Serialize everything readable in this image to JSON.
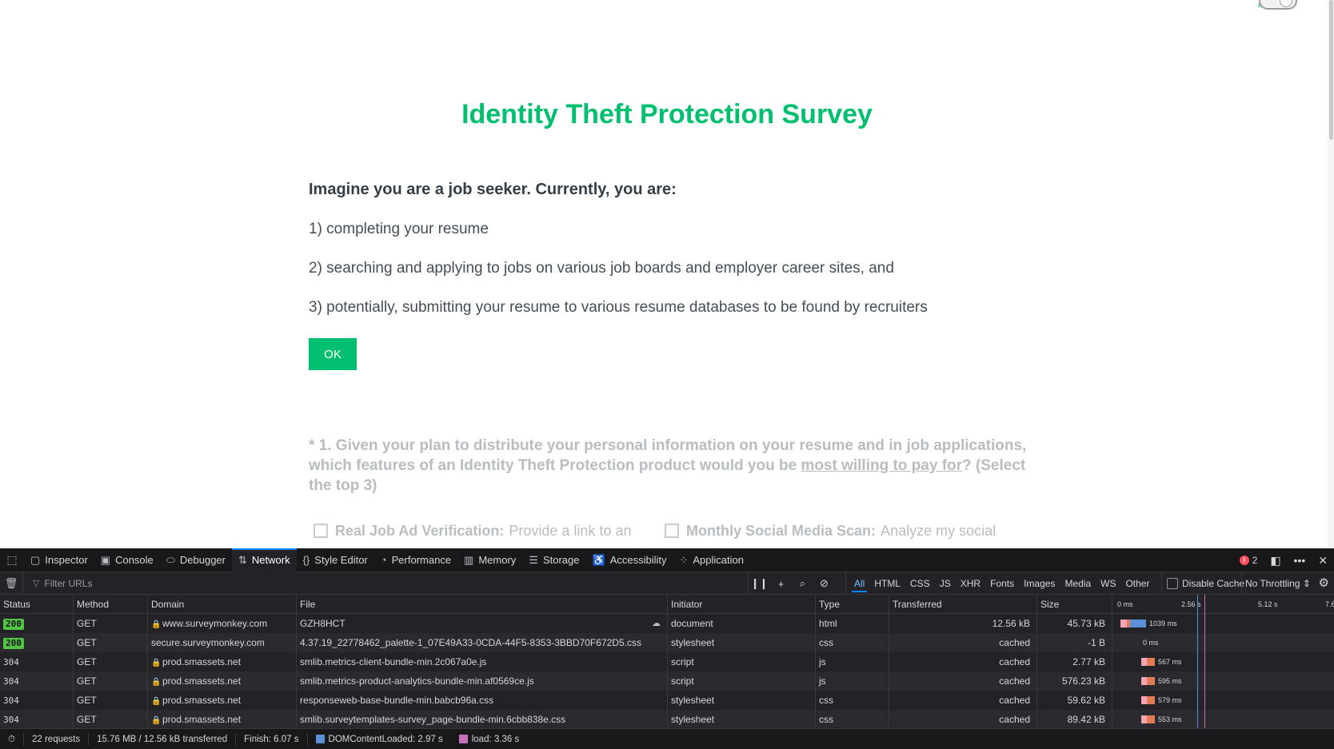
{
  "survey": {
    "title": "Identity Theft Protection Survey",
    "intro_heading": "Imagine you are a job seeker. Currently, you are:",
    "intro_lines": [
      "1) completing your resume",
      "2) searching and applying to jobs on various job boards and employer career sites, and",
      "3) potentially, submitting your resume to various resume databases to be found by recruiters"
    ],
    "ok_label": "OK",
    "question1": {
      "prefix": "* 1. Given your plan to distribute your personal information on your resume and in job applications, which features of an Identity Theft Protection product would you be ",
      "emphasis": "most willing to pay for",
      "suffix": "? (Select the top 3)"
    },
    "options": [
      {
        "title": "Real Job Ad Verification:",
        "desc": "Provide a link to an"
      },
      {
        "title": "Monthly Social Media Scan:",
        "desc": "Analyze my social"
      }
    ],
    "brand_color": "#00bf6f"
  },
  "devtools": {
    "tabs": [
      {
        "label": "Inspector",
        "icon": "inspector-icon"
      },
      {
        "label": "Console",
        "icon": "console-icon"
      },
      {
        "label": "Debugger",
        "icon": "debugger-icon"
      },
      {
        "label": "Network",
        "icon": "network-icon",
        "active": true
      },
      {
        "label": "Style Editor",
        "icon": "style-editor-icon"
      },
      {
        "label": "Performance",
        "icon": "performance-icon"
      },
      {
        "label": "Memory",
        "icon": "memory-icon"
      },
      {
        "label": "Storage",
        "icon": "storage-icon"
      },
      {
        "label": "Accessibility",
        "icon": "accessibility-icon"
      },
      {
        "label": "Application",
        "icon": "application-icon"
      }
    ],
    "error_count": "2",
    "filter_placeholder": "Filter URLs",
    "type_filters": [
      "All",
      "HTML",
      "CSS",
      "JS",
      "XHR",
      "Fonts",
      "Images",
      "Media",
      "WS",
      "Other"
    ],
    "active_filter": "All",
    "disable_cache_label": "Disable Cache",
    "throttling_label": "No Throttling",
    "columns": {
      "status": "Status",
      "method": "Method",
      "domain": "Domain",
      "file": "File",
      "initiator": "Initiator",
      "type": "Type",
      "transferred": "Transferred",
      "size": "Size"
    },
    "timeline_ticks": [
      "0 ms",
      "2.56 s",
      "5.12 s",
      "7.6"
    ],
    "requests": [
      {
        "status": "200",
        "method": "GET",
        "secure": true,
        "domain": "www.surveymonkey.com",
        "file": "GZH8HCT",
        "initiator": "document",
        "type": "html",
        "transferred": "12.56 kB",
        "size": "45.73 kB",
        "timing": "1039 ms",
        "throttled": true
      },
      {
        "status": "200",
        "method": "GET",
        "secure": false,
        "domain": "secure.surveymonkey.com",
        "file": "4.37.19_22778462_palette-1_07E49A33-0CDA-44F5-8353-3BBD70F672D5.css",
        "initiator": "stylesheet",
        "type": "css",
        "transferred": "cached",
        "size": "-1 B",
        "timing": "0 ms"
      },
      {
        "status": "304",
        "method": "GET",
        "secure": true,
        "domain": "prod.smassets.net",
        "file": "smlib.metrics-client-bundle-min.2c067a0e.js",
        "initiator": "script",
        "type": "js",
        "transferred": "cached",
        "size": "2.77 kB",
        "timing": "567 ms"
      },
      {
        "status": "304",
        "method": "GET",
        "secure": true,
        "domain": "prod.smassets.net",
        "file": "smlib.metrics-product-analytics-bundle-min.af0569ce.js",
        "initiator": "script",
        "type": "js",
        "transferred": "cached",
        "size": "576.23 kB",
        "timing": "595 ms"
      },
      {
        "status": "304",
        "method": "GET",
        "secure": true,
        "domain": "prod.smassets.net",
        "file": "responseweb-base-bundle-min.babcb96a.css",
        "initiator": "stylesheet",
        "type": "css",
        "transferred": "cached",
        "size": "59.62 kB",
        "timing": "579 ms"
      },
      {
        "status": "304",
        "method": "GET",
        "secure": true,
        "domain": "prod.smassets.net",
        "file": "smlib.surveytemplates-survey_page-bundle-min.6cbb838e.css",
        "initiator": "stylesheet",
        "type": "css",
        "transferred": "cached",
        "size": "89.42 kB",
        "timing": "553 ms"
      }
    ],
    "status_bar": {
      "requests": "22 requests",
      "transferred": "15.76 MB / 12.56 kB transferred",
      "finish": "Finish: 6.07 s",
      "dom_content_loaded": "DOMContentLoaded: 2.97 s",
      "load": "load: 3.36 s",
      "dcl_color": "#5b8fd6",
      "load_color": "#c970b8"
    }
  }
}
